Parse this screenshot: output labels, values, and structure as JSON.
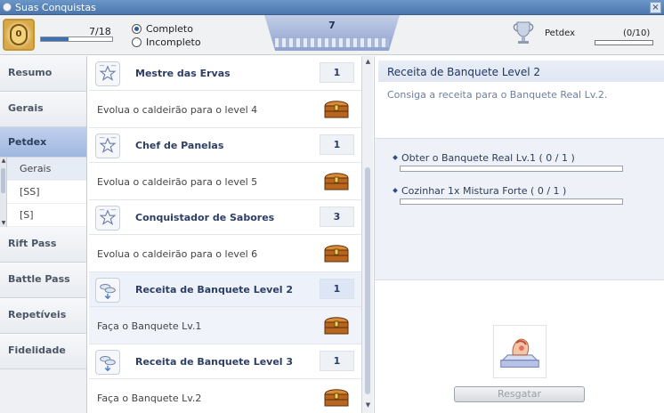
{
  "window": {
    "title": "Suas Conquistas",
    "close_glyph": "×"
  },
  "header": {
    "medal_text": "0",
    "progress_text": "7/18",
    "progress_fraction": 0.3889,
    "filters": [
      {
        "label": "Completo",
        "selected": true
      },
      {
        "label": "Incompleto",
        "selected": false
      }
    ],
    "banner_number": "7",
    "petdex_label": "Petdex",
    "petdex_count": "(0/10)",
    "petdex_fraction": 0.0
  },
  "sidebar": {
    "items": [
      {
        "label": "Resumo"
      },
      {
        "label": "Gerais"
      },
      {
        "label": "Petdex"
      },
      {
        "label": "Rift Pass"
      },
      {
        "label": "Battle Pass"
      },
      {
        "label": "Repetíveis"
      },
      {
        "label": "Fidelidade"
      }
    ],
    "sub_items": [
      {
        "label": "Gerais"
      },
      {
        "label": "[SS]"
      },
      {
        "label": "[S]"
      }
    ]
  },
  "achievements": [
    {
      "title": "Mestre das Ervas",
      "count": "1",
      "description": "Evolua o caldeirão para o level 4"
    },
    {
      "title": "Chef de Panelas",
      "count": "1",
      "description": "Evolua o caldeirão para o level 5"
    },
    {
      "title": "Conquistador de Sabores",
      "count": "3",
      "description": "Evolua o caldeirão para o level 6"
    },
    {
      "title": "Receita de Banquete Level 2",
      "count": "1",
      "description": "Faça o Banquete Lv.1"
    },
    {
      "title": "Receita de Banquete Level 3",
      "count": "1",
      "description": "Faça o Banquete Lv.2"
    }
  ],
  "detail": {
    "title": "Receita de Banquete Level 2",
    "description": "Consiga a receita para o Banquete Real Lv.2.",
    "requirements": [
      {
        "label": "Obter o Banquete Real Lv.1 ( 0 / 1 )",
        "progress": 0.0
      },
      {
        "label": "Cozinhar 1x Mistura Forte ( 0 / 1 )",
        "progress": 0.0
      }
    ],
    "claim_button": "Resgatar"
  },
  "colors": {
    "accent": "#3f6fb3",
    "title_text": "#2d3d64",
    "selected_nav": "#9fb7e0"
  }
}
